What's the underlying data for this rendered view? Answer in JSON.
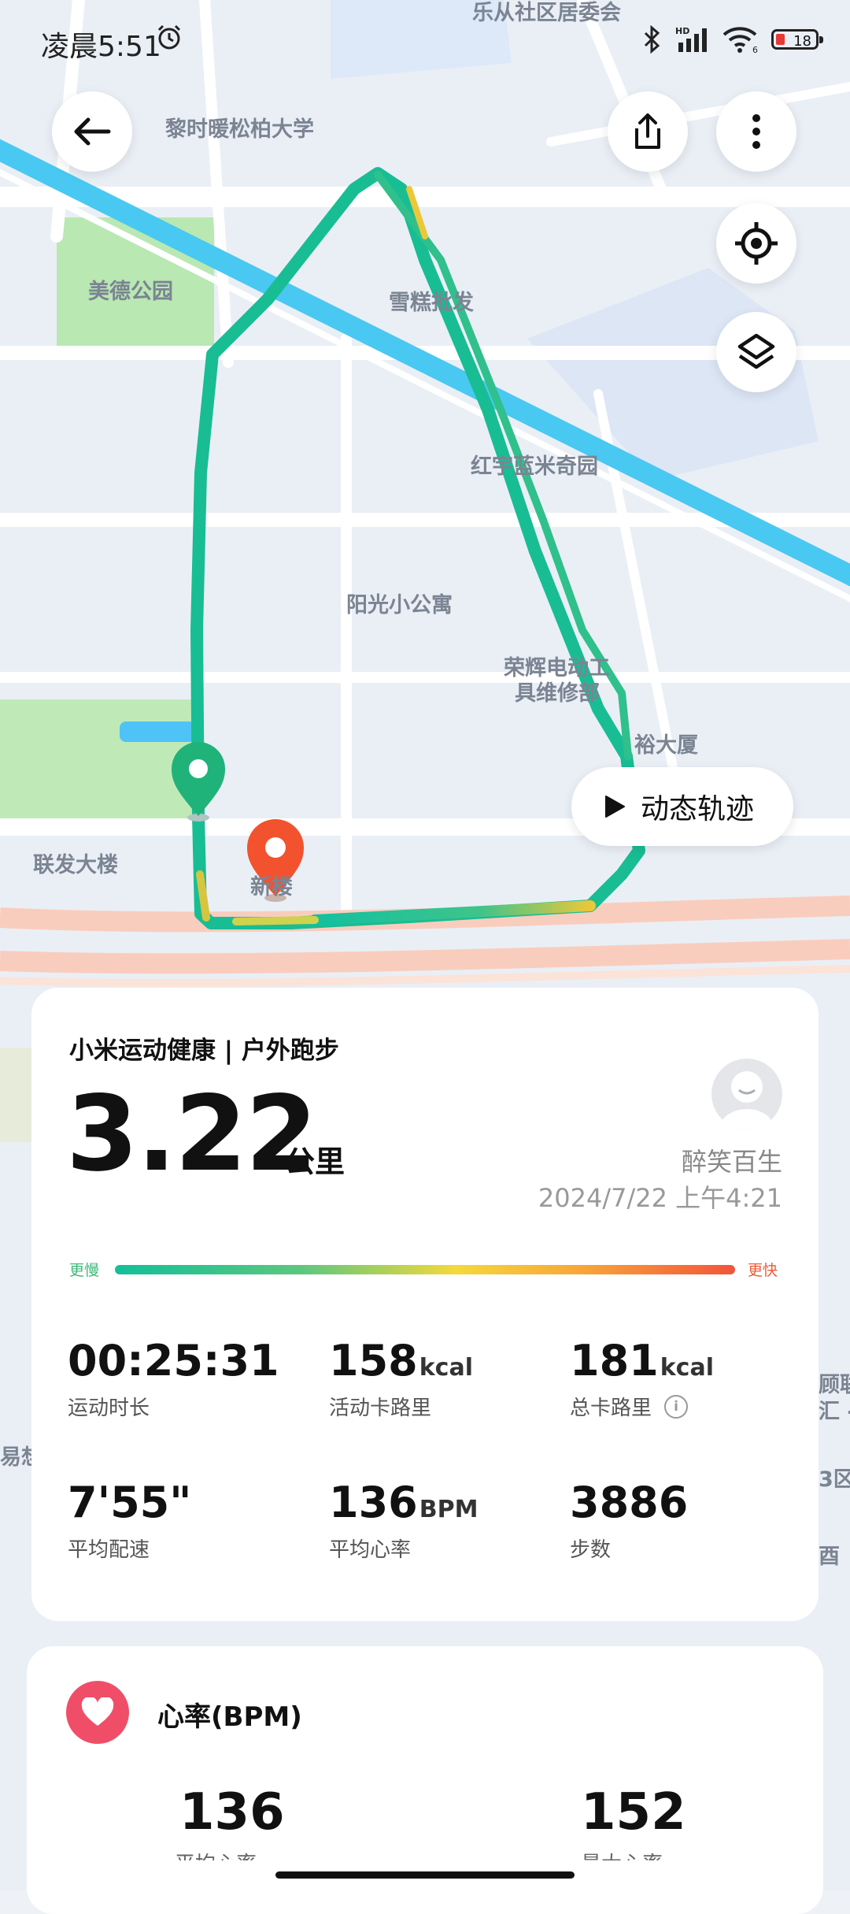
{
  "status_bar": {
    "time": "凌晨5:51",
    "battery": "18",
    "hd": "HD",
    "wifi_num": "6"
  },
  "map": {
    "labels": {
      "top_partial": "乐从社区居委会",
      "university": "黎时暖松柏大学",
      "park": "美德公园",
      "xuegao": "雪糕批发",
      "hongyu": "红宇蓝米奇园",
      "yangguang": "阳光小公寓",
      "ronghui1": "荣辉电动工",
      "ronghui2": "具维修部",
      "dasha": "裕大厦",
      "lianfa": "联发大楼",
      "start_bldg": "新楼",
      "right_edge1": "顾联",
      "right_edge2": "汇 -",
      "right_edge3": "3区",
      "right_edge4": "酉",
      "left_edge": "易想"
    }
  },
  "controls": {
    "replay_label": "动态轨迹"
  },
  "summary": {
    "source": "小米运动健康 | 户外跑步",
    "distance": "3.22",
    "distance_unit": "公里",
    "user_name": "醉笑百生",
    "datetime": "2024/7/22 上午4:21",
    "speed_slow": "更慢",
    "speed_fast": "更快"
  },
  "stats": {
    "duration": {
      "value": "00:25:31",
      "unit": "",
      "label": "运动时长"
    },
    "active_cal": {
      "value": "158",
      "unit": "kcal",
      "label": "活动卡路里"
    },
    "total_cal": {
      "value": "181",
      "unit": "kcal",
      "label": "总卡路里"
    },
    "pace": {
      "value": "7'55\"",
      "unit": "",
      "label": "平均配速"
    },
    "avg_hr": {
      "value": "136",
      "unit": "BPM",
      "label": "平均心率"
    },
    "steps": {
      "value": "3886",
      "unit": "",
      "label": "步数"
    }
  },
  "heart": {
    "title": "心率(BPM)",
    "avg_value": "136",
    "avg_label": "平均心率",
    "max_value": "152",
    "max_label": "最大心率"
  },
  "colors": {
    "route": "#13bf9a",
    "accent_heart": "#f04e68",
    "start_pin": "#1fb37a",
    "end_pin": "#f2522e"
  }
}
